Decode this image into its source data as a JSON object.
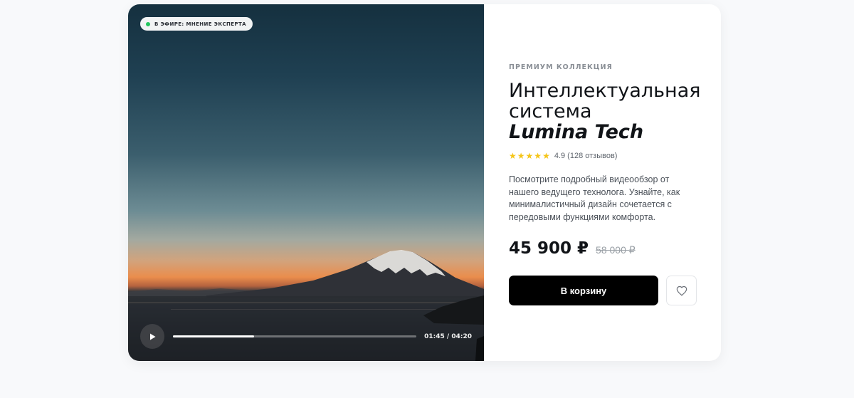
{
  "video": {
    "badge": "В ЭФИРЕ: МНЕНИЕ ЭКСПЕРТА",
    "time": "01:45 / 04:20",
    "progress_fraction": 0.333,
    "play_icon": "play-icon"
  },
  "product": {
    "eyebrow": "ПРЕМИУМ КОЛЛЕКЦИЯ",
    "title_line1": "Интеллектуальная",
    "title_line2": "система",
    "brand": "Lumina Tech",
    "rating_value": 4.9,
    "rating_text": "4.9 (128 отзывов)",
    "stars_count": 5,
    "description": "Посмотрите подробный видеообзор от нашего ведущего технолога. Узнайте, как минималистичный дизайн сочетается с передовыми функциями комфорта.",
    "price": "45 900 ₽",
    "old_price": "58 000 ₽",
    "cart_label": "В корзину",
    "favorite_icon": "heart-icon"
  },
  "colors": {
    "accent": "#000000",
    "star": "#f5c518",
    "live": "#22c55e"
  }
}
